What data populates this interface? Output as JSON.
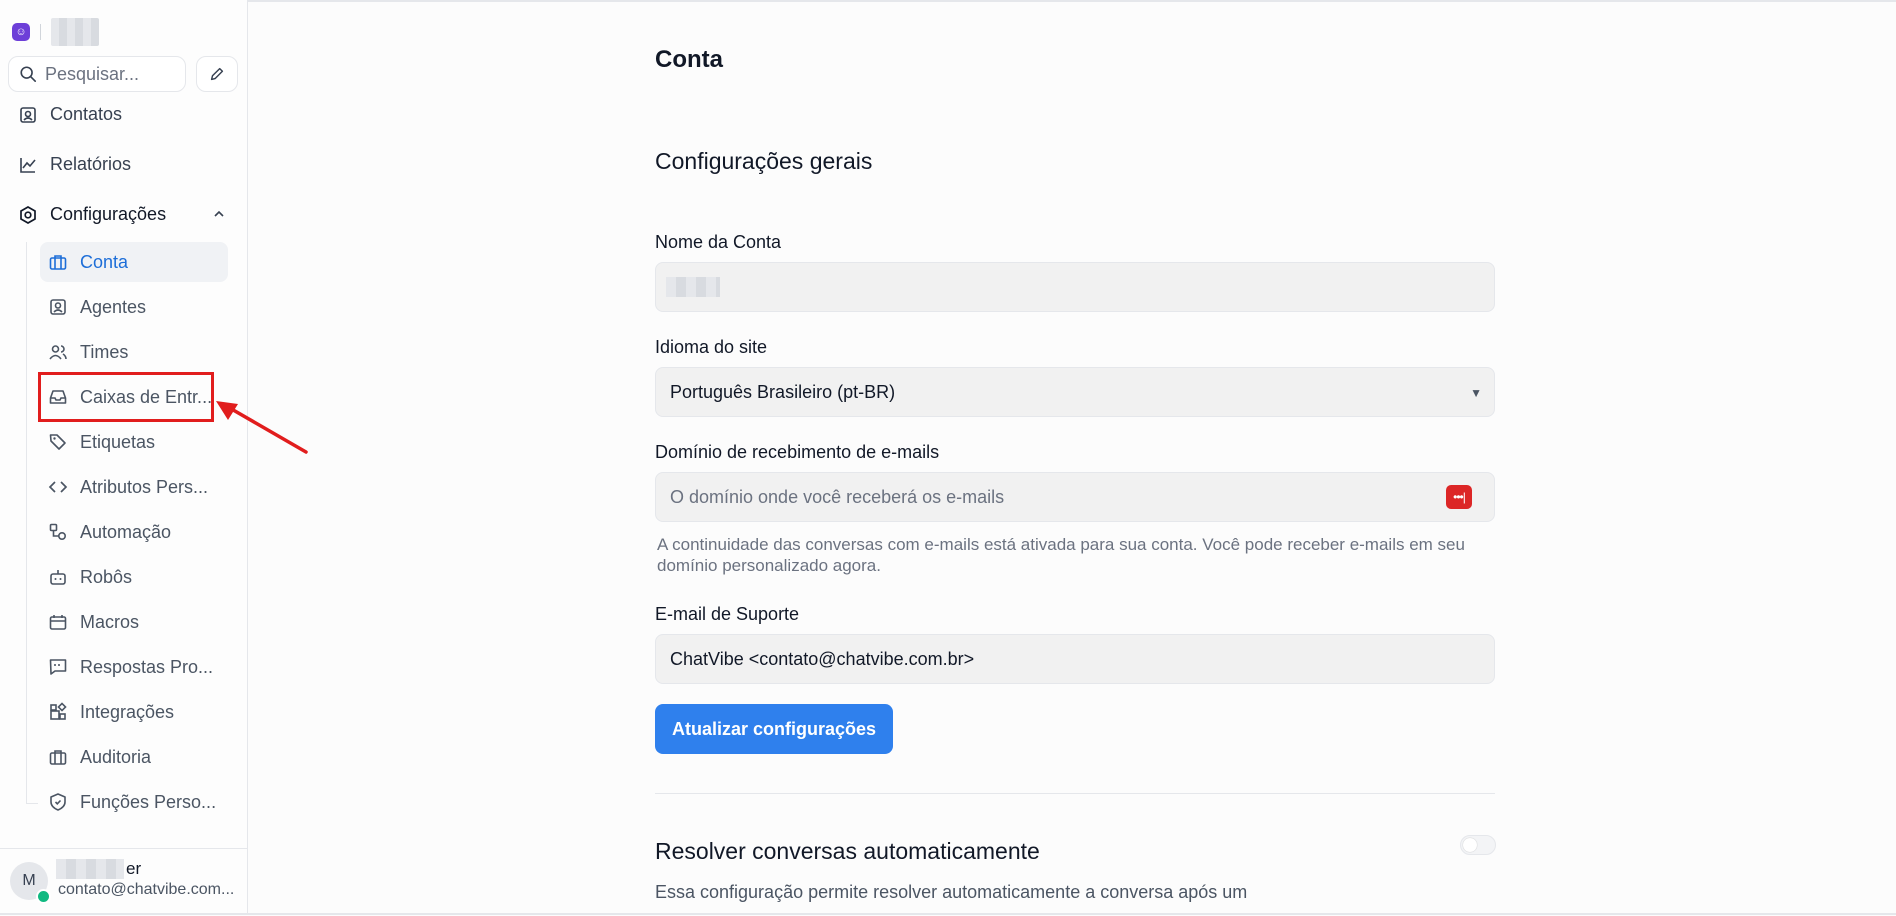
{
  "sidebar": {
    "brand_logo_glyph": "☺",
    "search_placeholder": "Pesquisar...",
    "nav": [
      {
        "label": "Contatos",
        "icon": "contacts-icon"
      },
      {
        "label": "Relatórios",
        "icon": "chart-icon"
      },
      {
        "label": "Configurações",
        "icon": "settings-icon"
      }
    ],
    "settings_items": [
      {
        "label": "Conta",
        "icon": "briefcase-icon",
        "active": true
      },
      {
        "label": "Agentes",
        "icon": "agent-icon"
      },
      {
        "label": "Times",
        "icon": "team-icon"
      },
      {
        "label": "Caixas de Entr...",
        "icon": "inbox-icon"
      },
      {
        "label": "Etiquetas",
        "icon": "tag-icon"
      },
      {
        "label": "Atributos Pers...",
        "icon": "code-icon"
      },
      {
        "label": "Automação",
        "icon": "automation-icon"
      },
      {
        "label": "Robôs",
        "icon": "bot-icon"
      },
      {
        "label": "Macros",
        "icon": "macro-icon"
      },
      {
        "label": "Respostas Pro...",
        "icon": "canned-response-icon"
      },
      {
        "label": "Integrações",
        "icon": "integrations-icon"
      },
      {
        "label": "Auditoria",
        "icon": "audit-icon"
      },
      {
        "label": "Funções Perso...",
        "icon": "shield-icon"
      }
    ],
    "user": {
      "initial": "M",
      "name_suffix": "er",
      "email": "contato@chatvibe.com..."
    }
  },
  "main": {
    "page_title": "Conta",
    "section_title": "Configurações gerais",
    "account_name_label": "Nome da Conta",
    "language_label": "Idioma do site",
    "language_value": "Português Brasileiro (pt-BR)",
    "email_domain_label": "Domínio de recebimento de e-mails",
    "email_domain_placeholder": "O domínio onde você receberá os e-mails",
    "email_domain_help": "A continuidade das conversas com e-mails está ativada para sua conta. Você pode receber e-mails em seu domínio personalizado agora.",
    "support_email_label": "E-mail de Suporte",
    "support_email_value": "ChatVibe <contato@chatvibe.com.br>",
    "update_button": "Atualizar configurações",
    "resolve_title": "Resolver conversas automaticamente",
    "resolve_desc": "Essa configuração permite resolver automaticamente a conversa após um"
  },
  "colors": {
    "accent": "#2f80ed",
    "active_nav_text": "#1d6ed8",
    "annotation_red": "#e11d1d",
    "online_green": "#10b981",
    "brand_purple": "#6d3fd8"
  }
}
